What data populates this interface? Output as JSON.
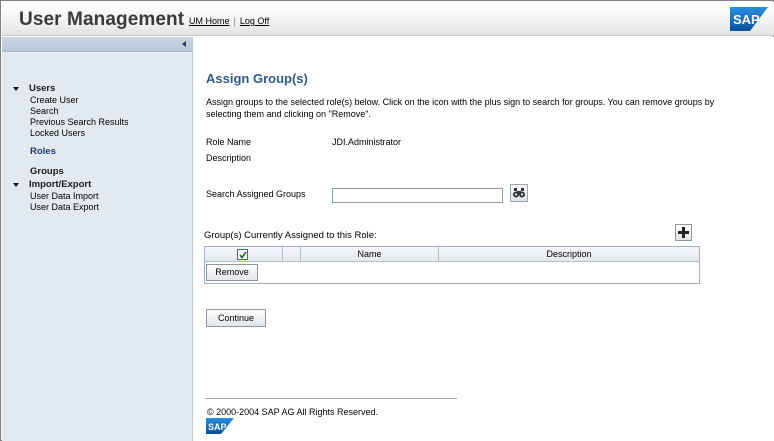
{
  "header": {
    "title": "User Management",
    "links": {
      "home": "UM Home",
      "sep": "|",
      "logoff": "Log Off"
    },
    "logo_text": "SAP"
  },
  "nav": {
    "users_label": "Users",
    "users_items": [
      "Create User",
      "Search",
      "Previous Search Results",
      "Locked Users"
    ],
    "roles_label": "Roles",
    "groups_label": "Groups",
    "import_label": "Import/Export",
    "import_items": [
      "User Data Import",
      "User Data Export"
    ]
  },
  "main": {
    "title": "Assign Group(s)",
    "instructions": "Assign groups to the selected role(s) below. Click on the icon with the plus sign to search for groups. You can remove groups by selecting them and clicking on \"Remove\".",
    "role_name_label": "Role Name",
    "role_name_value": "JDI.Administrator",
    "description_label": "Description",
    "description_value": "",
    "search_label": "Search Assigned Groups",
    "search_value": "",
    "group_title": "Group(s) Currently Assigned to this Role:",
    "columns": {
      "name": "Name",
      "description": "Description"
    },
    "remove_label": "Remove",
    "continue_label": "Continue"
  },
  "footer": {
    "copyright": "© 2000-2004 SAP AG All Rights Reserved.",
    "logo_text": "SAP"
  },
  "colors": {
    "title_blue": "#2f5a8d",
    "nav_bg": "#e3e9f1",
    "sap_blue": "#0b5cab"
  }
}
